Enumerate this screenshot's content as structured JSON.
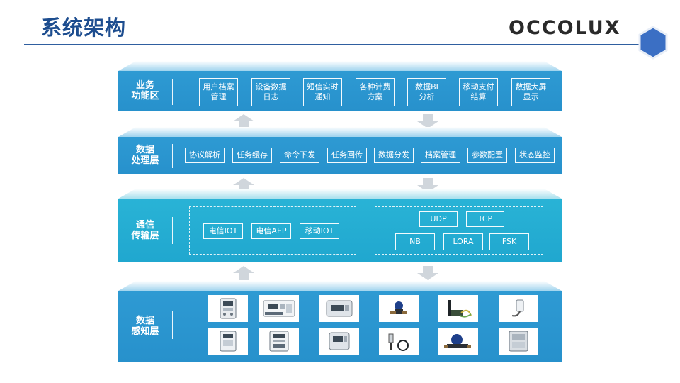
{
  "title": "系统架构",
  "logo": "OCCOLUX",
  "colors": {
    "title": "#1d4d8f",
    "band": "#2e9ad3",
    "transport_band": "#22abd2",
    "arrow": "#d0d6dc",
    "hex": "#3b6fc4"
  },
  "layers": [
    {
      "label": "业务\n功能区",
      "items": [
        "用户档案\n管理",
        "设备数据\n日志",
        "短信实时\n通知",
        "各种计费\n方案",
        "数据BI\n分析",
        "移动支付\n结算",
        "数据大屏\n显示"
      ]
    },
    {
      "label": "数据\n处理层",
      "items": [
        "协议解析",
        "任务缓存",
        "命令下发",
        "任务回传",
        "数据分发",
        "档案管理",
        "参数配置",
        "状态监控"
      ]
    },
    {
      "label": "通信\n传输层",
      "left_group": [
        "电信IOT",
        "电信AEP",
        "移动IOT"
      ],
      "right_group_top": [
        "UDP",
        "TCP"
      ],
      "right_group_bottom": [
        "NB",
        "LORA",
        "FSK"
      ]
    },
    {
      "label": "数据\n感知层",
      "devices_row1": [
        "single-phase-meter-icon",
        "din-rail-meter-icon",
        "gas-meter-icon",
        "water-valve-icon",
        "antenna-module-icon",
        "sensor-probe-icon"
      ],
      "devices_row2": [
        "prepaid-meter-icon",
        "three-phase-meter-icon",
        "smart-gas-meter-icon",
        "temperature-probe-icon",
        "water-meter-icon",
        "concentrator-icon"
      ]
    }
  ],
  "arrows": {
    "left": "up",
    "right": "down"
  }
}
